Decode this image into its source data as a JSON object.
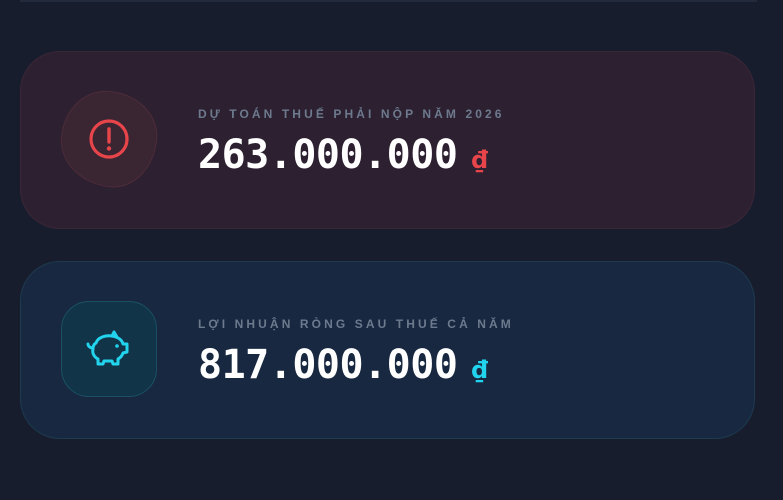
{
  "tax_card": {
    "label": "DỰ TOÁN THUẾ PHẢI NỘP NĂM 2026",
    "amount": "263.000.000",
    "currency": "₫",
    "icon": "alert-circle-icon",
    "accent_color": "#e8454a"
  },
  "profit_card": {
    "label": "LỢI NHUẬN RÒNG SAU THUẾ CẢ NĂM",
    "amount": "817.000.000",
    "currency": "₫",
    "icon": "piggy-bank-icon",
    "accent_color": "#22d3ee"
  }
}
